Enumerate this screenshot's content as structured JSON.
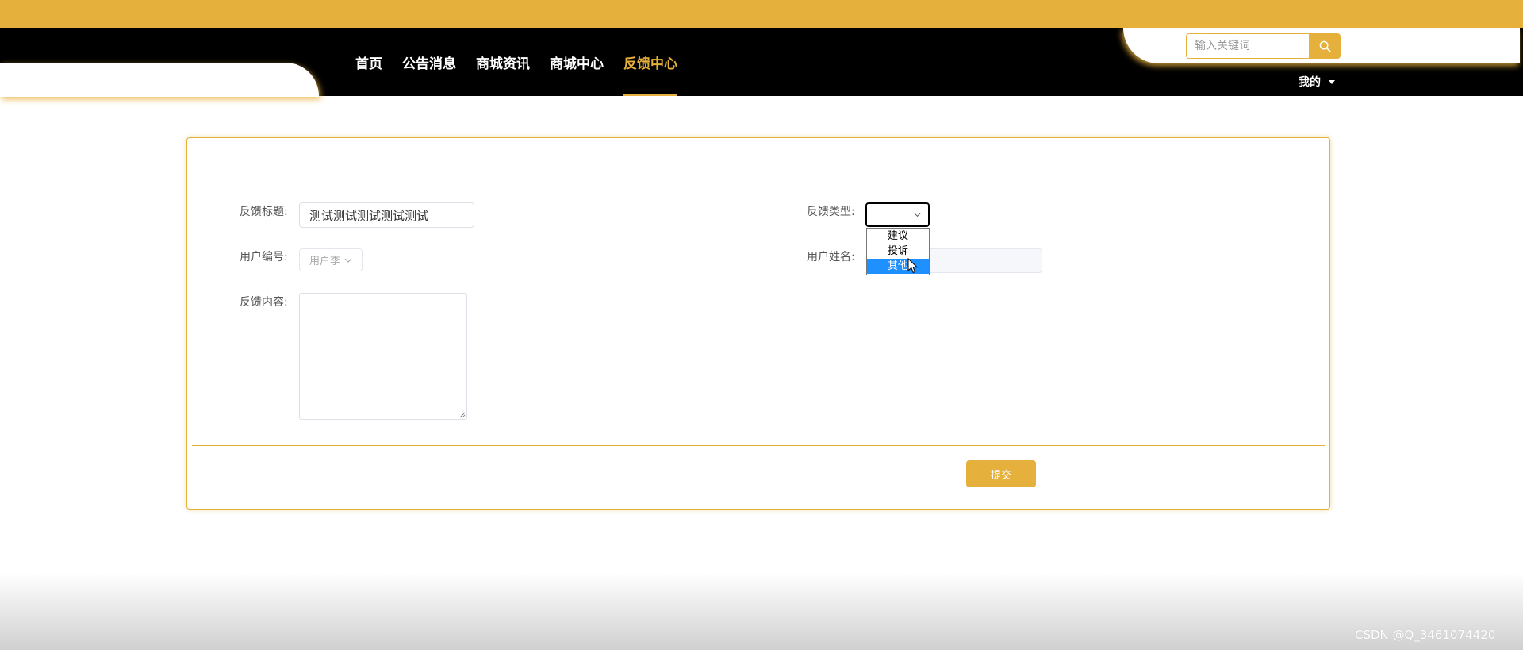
{
  "nav": {
    "items": [
      {
        "label": "首页"
      },
      {
        "label": "公告消息"
      },
      {
        "label": "商城资讯"
      },
      {
        "label": "商城中心"
      },
      {
        "label": "反馈中心"
      }
    ],
    "active_index": 4
  },
  "search": {
    "placeholder": "输入关键词",
    "button_icon": "search-icon"
  },
  "user_menu": {
    "label": "我的",
    "icon": "caret-down-icon"
  },
  "form": {
    "title_label": "反馈标题:",
    "title_value": "测试测试测试测试测试",
    "type_label": "反馈类型:",
    "type_value": "",
    "type_options": [
      "建议",
      "投诉",
      "其他"
    ],
    "type_highlighted": "其他",
    "user_id_label": "用户编号:",
    "user_id_value": "用户李",
    "user_name_label": "用户姓名:",
    "user_name_value": "",
    "content_label": "反馈内容:",
    "content_value": "",
    "submit_label": "提交"
  },
  "watermark": "CSDN @Q_3461074420",
  "colors": {
    "accent": "#e6b03c",
    "navbar_bg": "#000000",
    "dropdown_highlight": "#1e90ff"
  }
}
